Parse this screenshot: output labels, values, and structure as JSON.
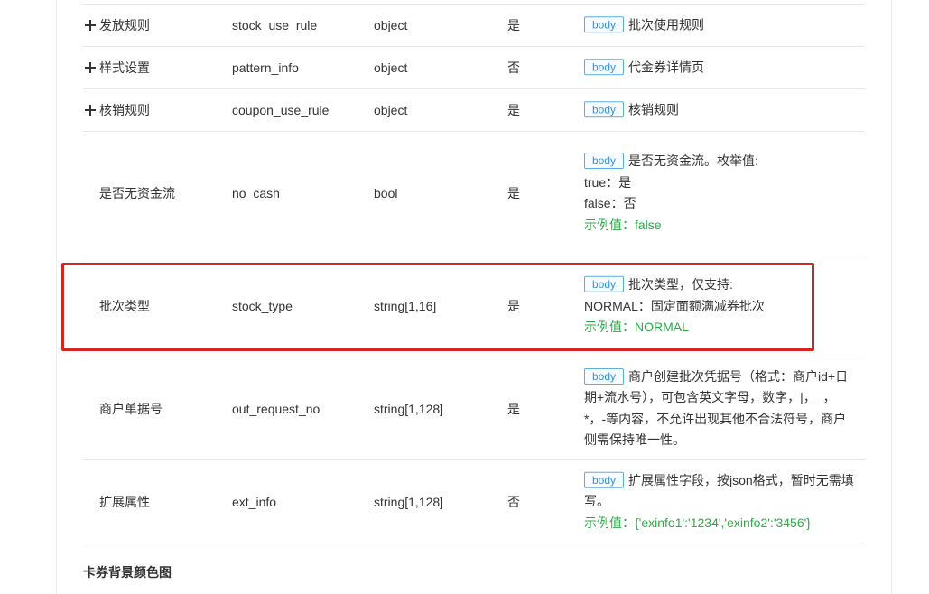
{
  "rows": [
    {
      "name": "发放规则",
      "field": "stock_use_rule",
      "type": "object",
      "required": "是",
      "tag": "body",
      "desc": [
        "批次使用规则"
      ],
      "example": ""
    },
    {
      "name": "样式设置",
      "field": "pattern_info",
      "type": "object",
      "required": "否",
      "tag": "body",
      "desc": [
        "代金券详情页"
      ],
      "example": ""
    },
    {
      "name": "核销规则",
      "field": "coupon_use_rule",
      "type": "object",
      "required": "是",
      "tag": "body",
      "desc": [
        "核销规则"
      ],
      "example": ""
    },
    {
      "name": "是否无资金流",
      "field": "no_cash",
      "type": "bool",
      "required": "是",
      "tag": "body",
      "desc": [
        "是否无资金流。枚举值:",
        "true：是",
        "false：否"
      ],
      "example": "示例值：false"
    },
    {
      "name": "批次类型",
      "field": "stock_type",
      "type": "string[1,16]",
      "required": "是",
      "tag": "body",
      "desc": [
        "批次类型，仅支持:",
        "NORMAL：固定面额满减券批次"
      ],
      "example": "示例值：NORMAL"
    },
    {
      "name": "商户单据号",
      "field": "out_request_no",
      "type": "string[1,128]",
      "required": "是",
      "tag": "body",
      "desc": [
        "商户创建批次凭据号（格式：商户id+日期+流水号），可包含英文字母，数字，|，_，*，-等内容，不允许出现其他不合法符号，商户侧需保持唯一性。"
      ],
      "example": ""
    },
    {
      "name": "扩展属性",
      "field": "ext_info",
      "type": "string[1,128]",
      "required": "否",
      "tag": "body",
      "desc": [
        "扩展属性字段，按json格式，暂时无需填写。"
      ],
      "example": "示例值：{'exinfo1':'1234','exinfo2':'3456'}"
    }
  ],
  "section_title": "卡券背景颜色图",
  "colors": {
    "tag": "#3a8fd9",
    "example": "#2eaa47",
    "highlight": "#d4261e"
  }
}
